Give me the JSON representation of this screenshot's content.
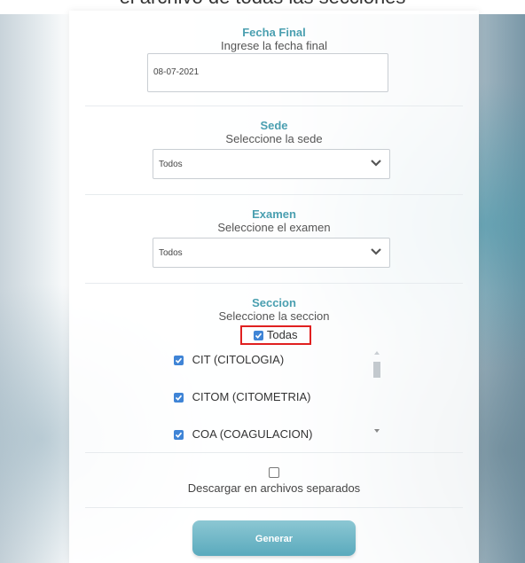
{
  "top_strip": {
    "text": "el archivo de todas las secciones"
  },
  "fecha_final": {
    "title": "Fecha Final",
    "subtitle": "Ingrese la fecha final",
    "value": "08-07-2021"
  },
  "sede": {
    "title": "Sede",
    "subtitle": "Seleccione la sede",
    "selected": "Todos"
  },
  "examen": {
    "title": "Examen",
    "subtitle": "Seleccione el examen",
    "selected": "Todos"
  },
  "seccion": {
    "title": "Seccion",
    "subtitle": "Seleccione la seccion",
    "all_label": "Todas",
    "all_checked": true,
    "items": [
      {
        "label": "CIT (CITOLOGIA)",
        "checked": true
      },
      {
        "label": "CITOM (CITOMETRIA)",
        "checked": true
      },
      {
        "label": "COA (COAGULACION)",
        "checked": true
      }
    ]
  },
  "descargar": {
    "label": "Descargar en archivos separados",
    "checked": false
  },
  "generar_button": {
    "label": "Generar"
  },
  "colors": {
    "accent_title": "#4a9fb0",
    "checkbox": "#3f84d6",
    "highlight_box": "#e02020",
    "button": "#6ab4c6"
  }
}
